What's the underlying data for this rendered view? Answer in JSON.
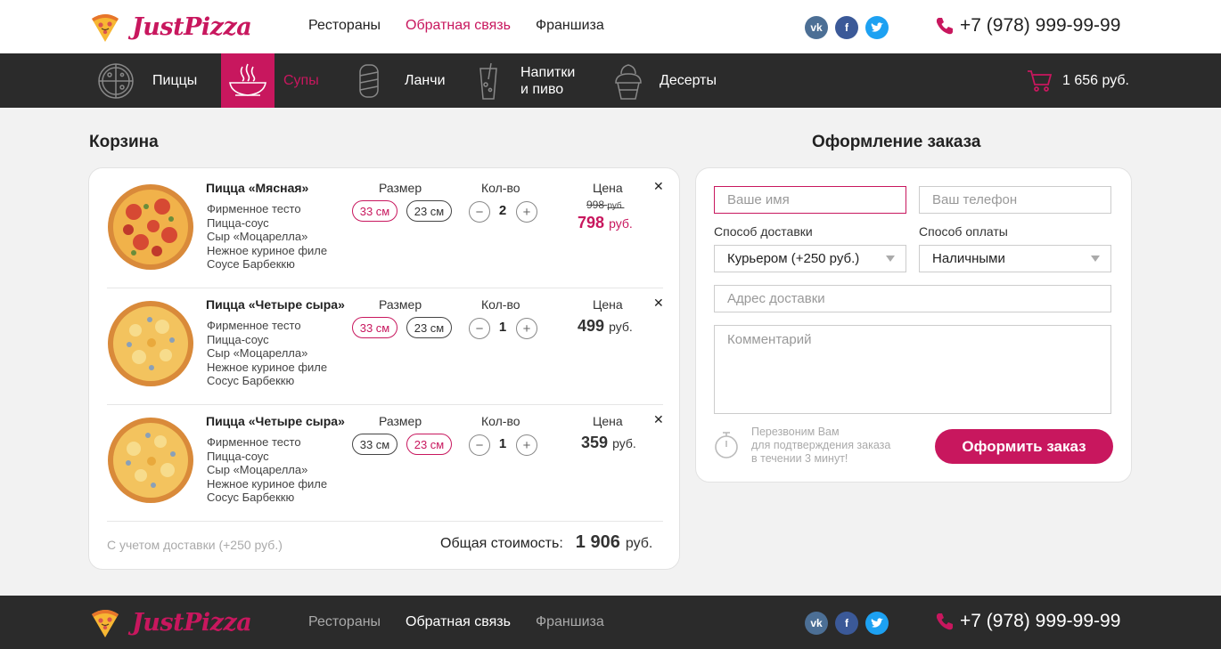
{
  "brand": {
    "name": "JustPizza",
    "accent": "#c8175e"
  },
  "header": {
    "nav": [
      "Рестораны",
      "Обратная связь",
      "Франшиза"
    ],
    "active_nav": 1,
    "socials": [
      "vk-icon",
      "facebook-icon",
      "twitter-icon"
    ],
    "phone": "+7 (978) 999-99-99"
  },
  "categories": [
    {
      "label": "Пиццы",
      "icon": "pizza-icon"
    },
    {
      "label": "Супы",
      "icon": "soup-icon",
      "active": true
    },
    {
      "label": "Ланчи",
      "icon": "burrito-icon"
    },
    {
      "label_line1": "Напитки",
      "label_line2": "и пиво",
      "icon": "drink-icon"
    },
    {
      "label": "Десерты",
      "icon": "dessert-icon"
    }
  ],
  "cart": {
    "total": "1 656 руб."
  },
  "basket": {
    "title": "Корзина",
    "col_size": "Размер",
    "col_qty": "Кол-во",
    "col_price": "Цена",
    "size_options": [
      "33 см",
      "23 см"
    ],
    "items": [
      {
        "name": "Пицца «Мясная»",
        "ingredients": [
          "Фирменное тесто",
          "Пицца-соус",
          "Сыр «Моцарелла»",
          "Нежное куриное филе",
          "Соусе Барбеккю"
        ],
        "selected_size": 0,
        "qty": "2",
        "old_price": "998",
        "old_price_unit": "руб.",
        "price": "798",
        "price_unit": "руб.",
        "discount": true
      },
      {
        "name": "Пицца «Четыре сыра»",
        "ingredients": [
          "Фирменное тесто",
          "Пицца-соус",
          "Сыр «Моцарелла»",
          "Нежное куриное филе",
          "Сосус Барбеккю"
        ],
        "selected_size": 0,
        "qty": "1",
        "price": "499",
        "price_unit": "руб."
      },
      {
        "name": "Пицца «Четыре сыра»",
        "ingredients": [
          "Фирменное тесто",
          "Пицца-соус",
          "Сыр «Моцарелла»",
          "Нежное куриное филе",
          "Сосус Барбеккю"
        ],
        "selected_size": 1,
        "qty": "1",
        "price": "359",
        "price_unit": "руб."
      }
    ],
    "delivery_note": "С учетом доставки (+250 руб.)",
    "total_label": "Общая стоимость:",
    "total_value": "1 906",
    "total_unit": "руб."
  },
  "order": {
    "title": "Оформление заказа",
    "name_placeholder": "Ваше имя",
    "phone_placeholder": "Ваш телефон",
    "delivery_label": "Способ доставки",
    "delivery_value": "Курьером (+250 руб.)",
    "payment_label": "Способ оплаты",
    "payment_value": "Наличными",
    "address_placeholder": "Адрес доставки",
    "comment_placeholder": "Комментарий",
    "note_lines": [
      "Перезвоним Вам",
      "для подтверждения заказа",
      "в течении 3 минут!"
    ],
    "submit": "Оформить заказ"
  },
  "footer": {
    "nav": [
      "Рестораны",
      "Обратная связь",
      "Франшиза"
    ],
    "active_nav": 1,
    "phone": "+7 (978) 999-99-99"
  }
}
